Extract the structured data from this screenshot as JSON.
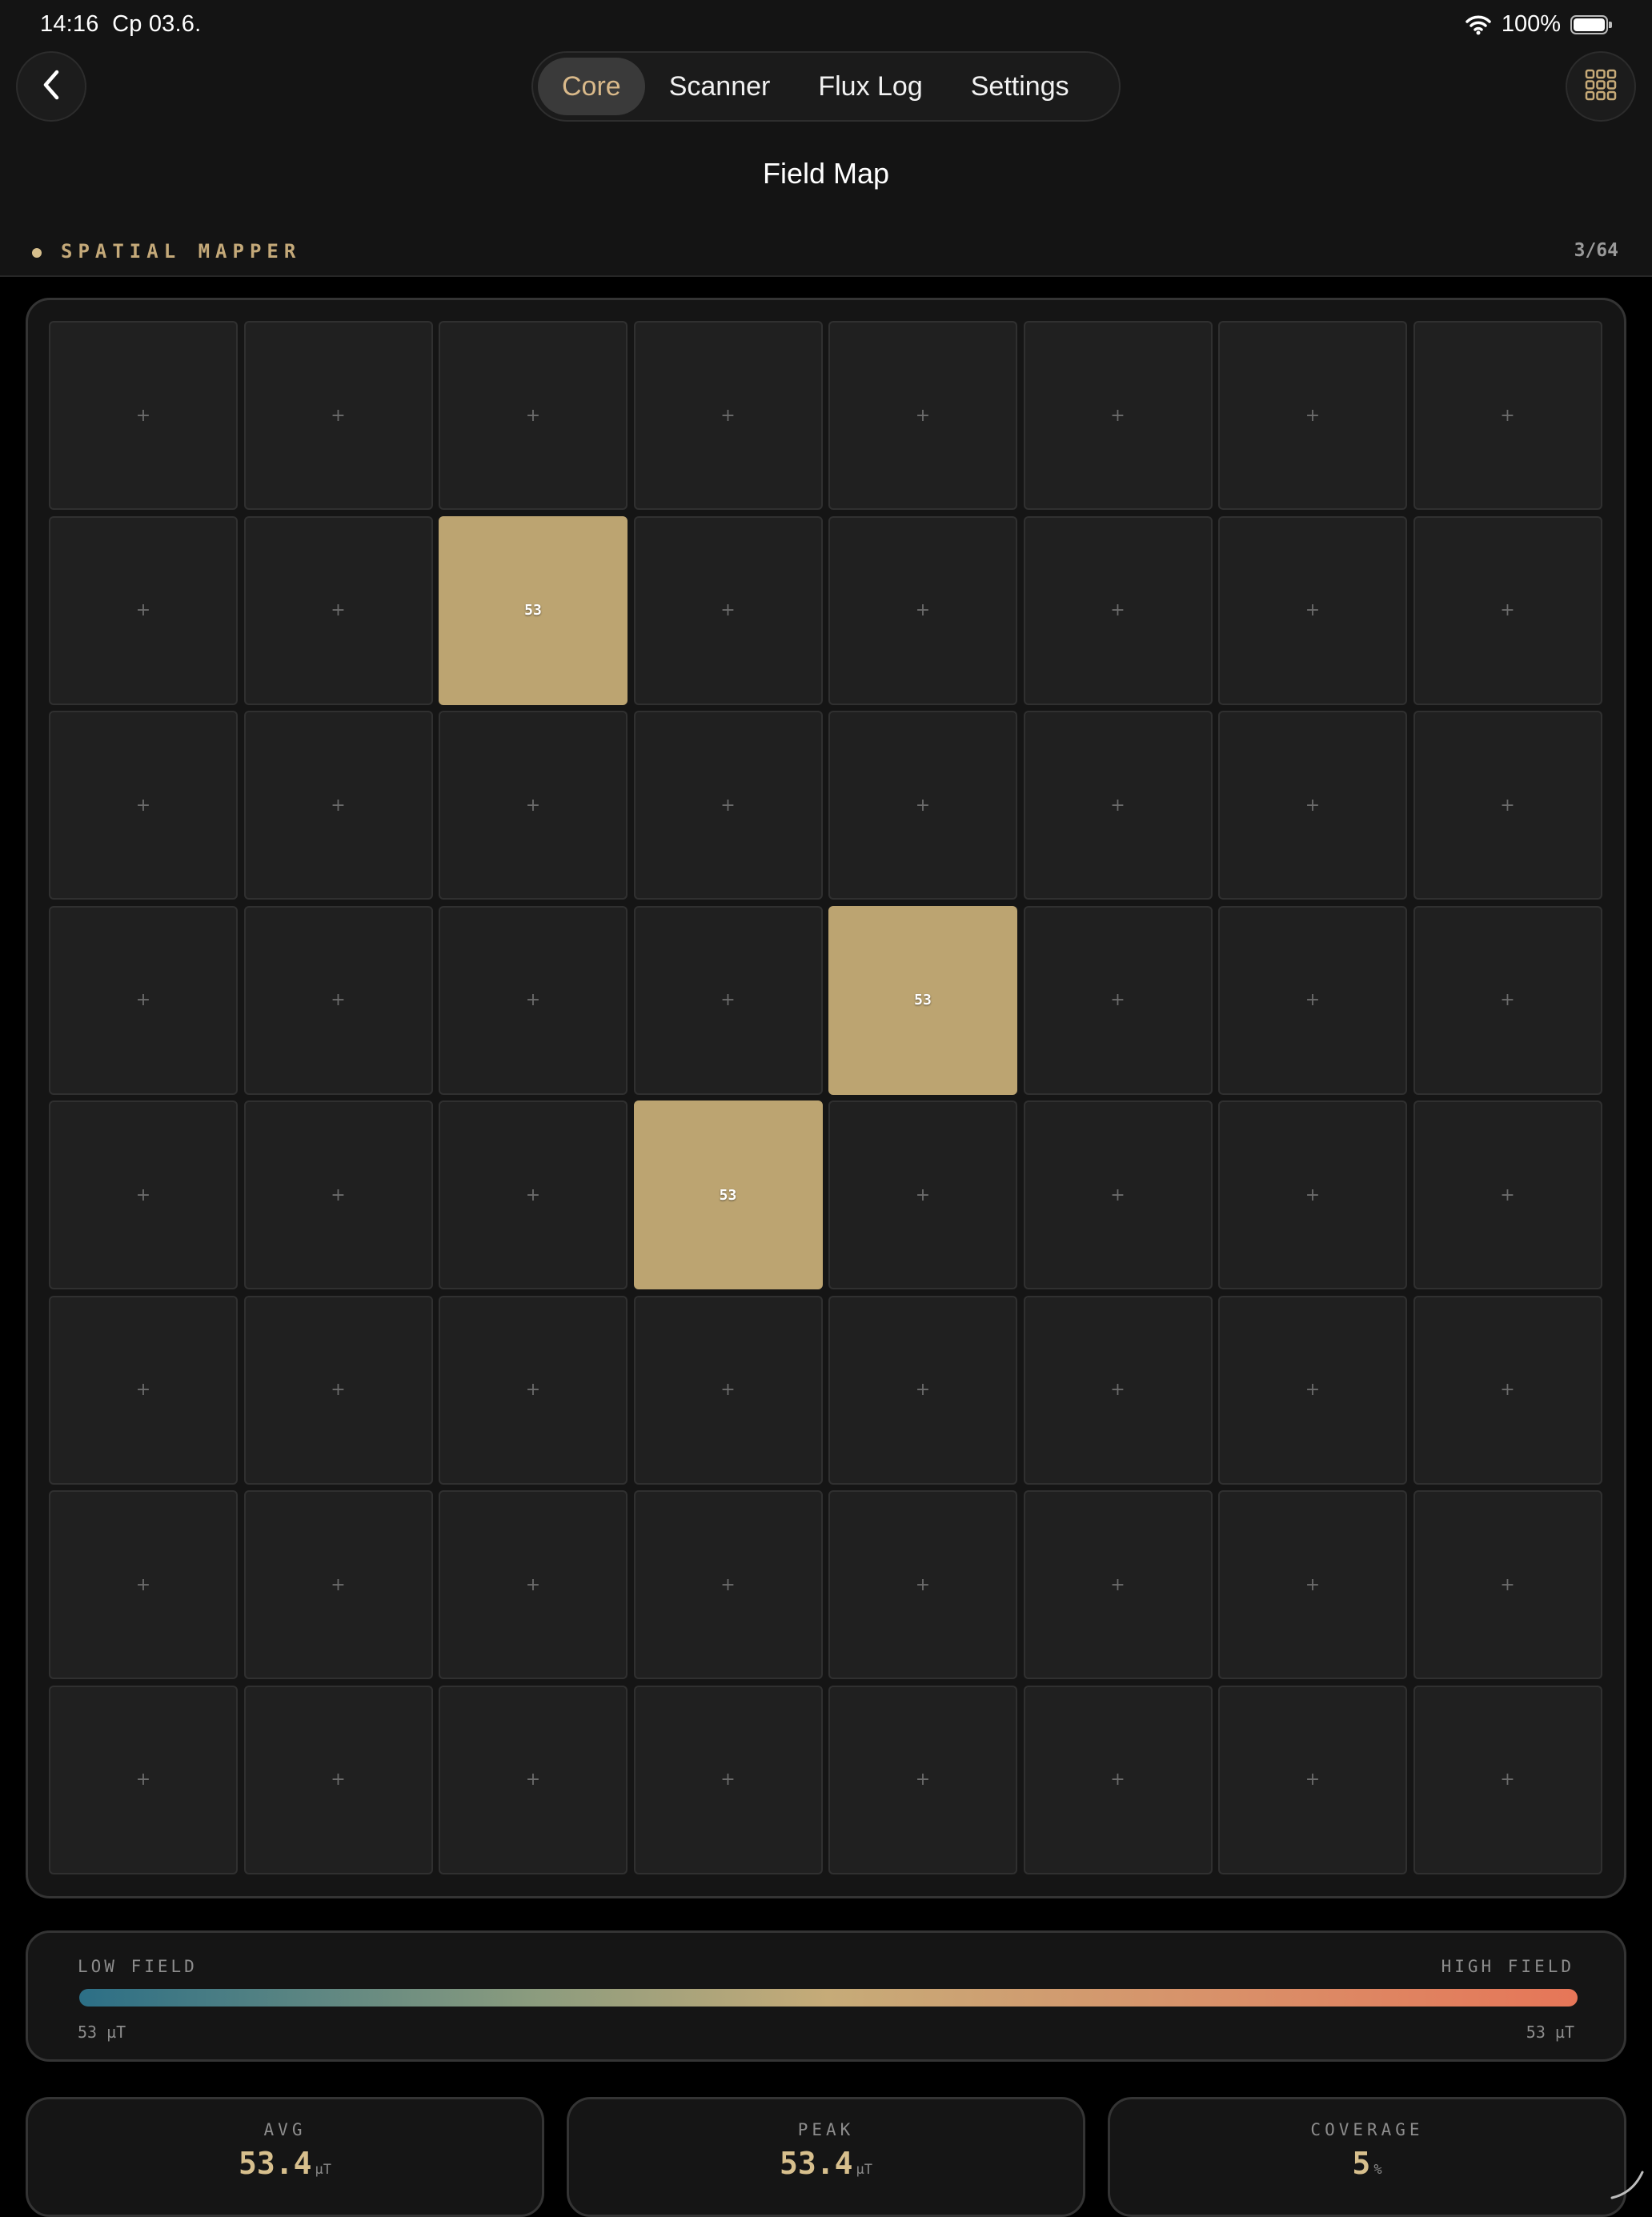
{
  "status_bar": {
    "time": "14:16",
    "date": "Cp 03.6.",
    "battery": "100%"
  },
  "nav": {
    "back_icon": "chevron-left-icon",
    "apps_icon": "grid-icon",
    "tabs": [
      {
        "label": "Core",
        "active": true
      },
      {
        "label": "Scanner",
        "active": false
      },
      {
        "label": "Flux Log",
        "active": false
      },
      {
        "label": "Settings",
        "active": false
      }
    ]
  },
  "page": {
    "title": "Field Map"
  },
  "section": {
    "label": "SPATIAL MAPPER",
    "count": "3/64"
  },
  "grid": {
    "empty_symbol": "+",
    "rows": [
      [
        null,
        null,
        null,
        null,
        null,
        null,
        null,
        null
      ],
      [
        null,
        null,
        "53",
        null,
        null,
        null,
        null,
        null
      ],
      [
        null,
        null,
        null,
        null,
        null,
        null,
        null,
        null
      ],
      [
        null,
        null,
        null,
        null,
        "53",
        null,
        null,
        null
      ],
      [
        null,
        null,
        null,
        "53",
        null,
        null,
        null,
        null
      ],
      [
        null,
        null,
        null,
        null,
        null,
        null,
        null,
        null
      ],
      [
        null,
        null,
        null,
        null,
        null,
        null,
        null,
        null
      ],
      [
        null,
        null,
        null,
        null,
        null,
        null,
        null,
        null
      ]
    ]
  },
  "legend": {
    "low_label": "LOW FIELD",
    "high_label": "HIGH FIELD",
    "min": "53 µT",
    "max": "53 µT"
  },
  "stats": {
    "avg": {
      "label": "AVG",
      "value": "53.4",
      "unit": "µT"
    },
    "peak": {
      "label": "PEAK",
      "value": "53.4",
      "unit": "µT"
    },
    "coverage": {
      "label": "COVERAGE",
      "value": "5",
      "unit": "%"
    }
  },
  "colors": {
    "accent": "#d7bf8d",
    "filled_cell": "#bca471",
    "gradient_low": "#2c6f86",
    "gradient_high": "#e67658"
  }
}
